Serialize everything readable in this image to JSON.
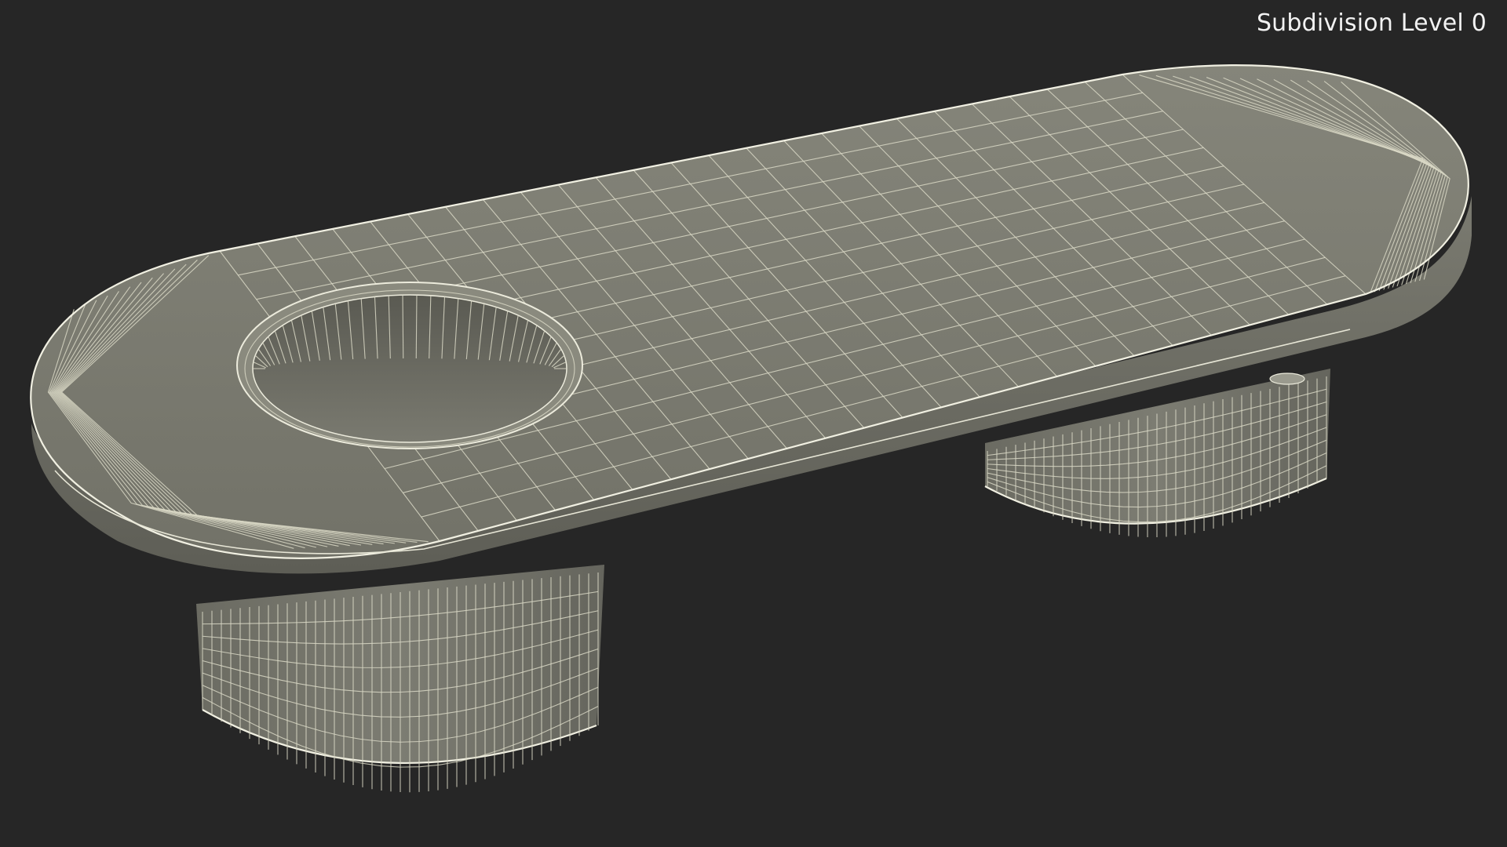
{
  "viewport": {
    "label": "Subdivision Level 0",
    "background_color": "#262626",
    "mesh_color": "#7a7a6f",
    "wire_color": "#d9d8c6"
  }
}
